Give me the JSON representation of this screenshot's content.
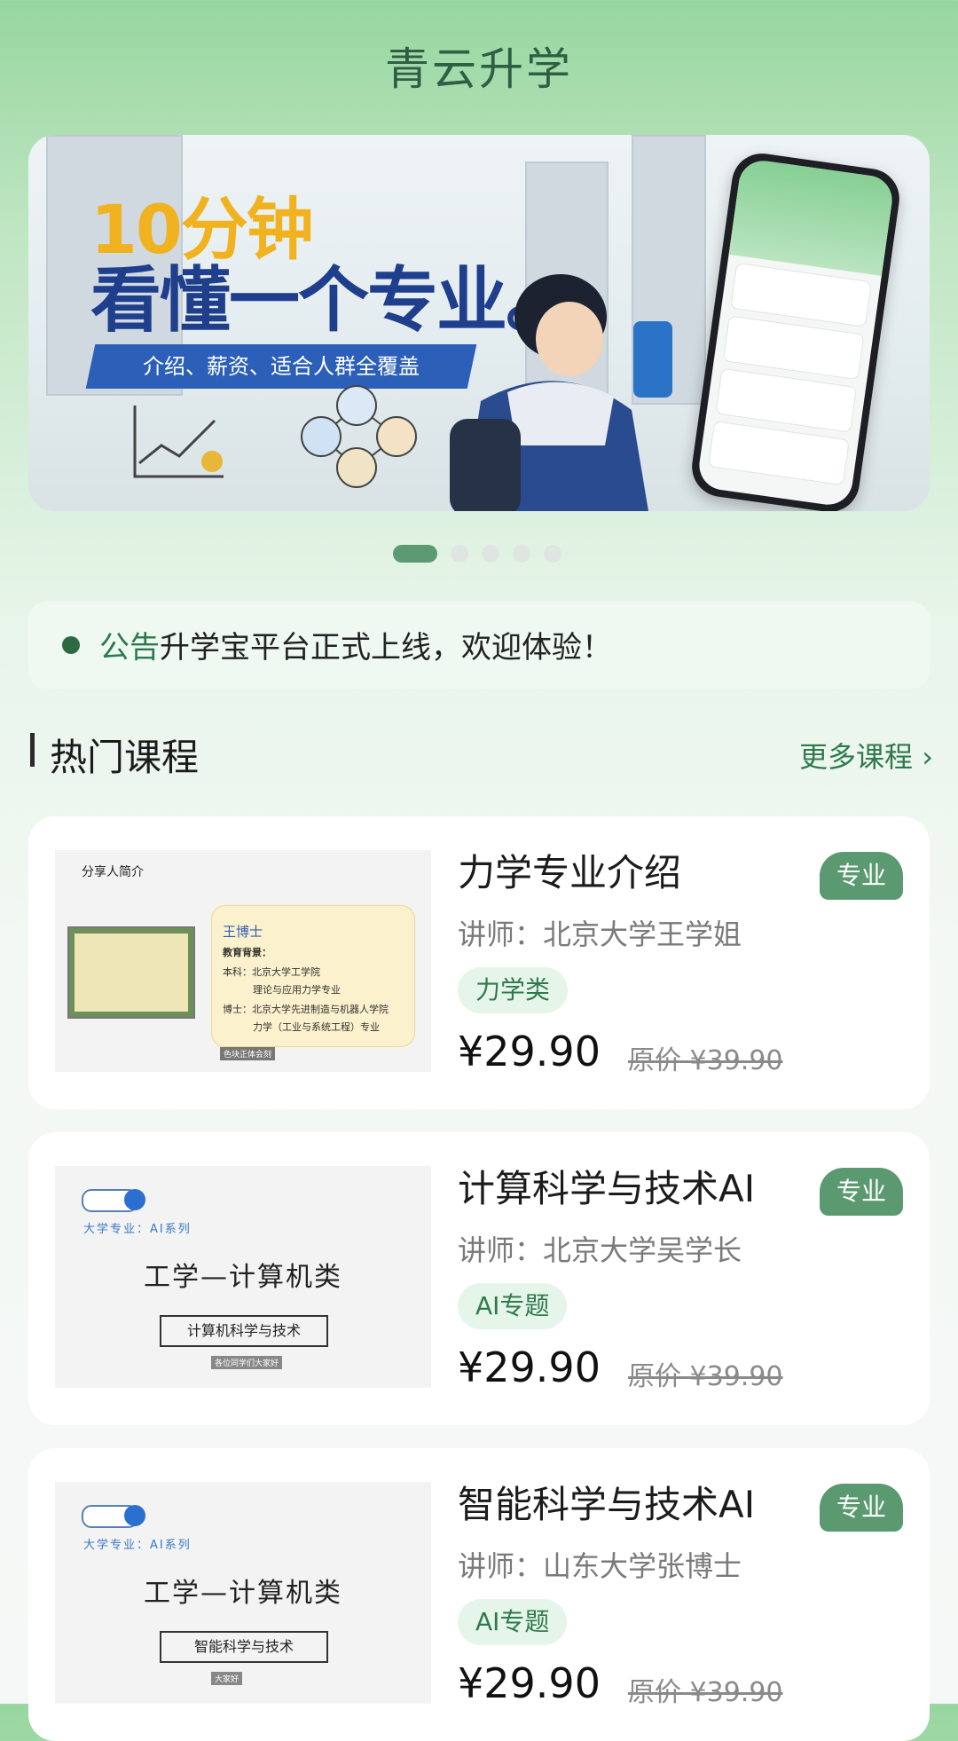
{
  "app": {
    "title": "青云升学"
  },
  "banner": {
    "headline1": "10分钟",
    "headline2": "看懂一个专业。",
    "strip": "介绍、薪资、适合人群全覆盖",
    "slides": 5,
    "active_slide": 1
  },
  "notice": {
    "tag": "公告",
    "text": "升学宝平台正式上线，欢迎体验！"
  },
  "section": {
    "title": "热门课程",
    "more": "更多课程 ›"
  },
  "courses": [
    {
      "title": "力学专业介绍",
      "badge": "专业",
      "teacher": "讲师：北京大学王学姐",
      "tag": "力学类",
      "price": "¥29.90",
      "original": "原价 ¥39.90",
      "thumb": {
        "heading": "分享人简介",
        "name": "王博士",
        "lines": [
          "教育背景：",
          "本科：北京大学工学院",
          "理论与应用力学专业",
          "博士：北京大学先进制造与机器人学院",
          "力学（工业与系统工程）专业"
        ],
        "footer": "色块正体会刻"
      }
    },
    {
      "title": "计算科学与技术AI",
      "badge": "专业",
      "teacher": "讲师：北京大学吴学长",
      "tag": "AI专题",
      "price": "¥29.90",
      "original": "原价 ¥39.90",
      "thumb": {
        "sub": "大学专业：AI系列",
        "big": "工学—计算机类",
        "box": "计算机科学与技术",
        "footer": "各位同学们大家好"
      }
    },
    {
      "title": "智能科学与技术AI",
      "badge": "专业",
      "teacher": "讲师：山东大学张博士",
      "tag": "AI专题",
      "price": "¥29.90",
      "original": "原价 ¥39.90",
      "thumb": {
        "sub": "大学专业：AI系列",
        "big": "工学—计算机类",
        "box": "智能科学与技术",
        "footer": "大家好"
      }
    }
  ],
  "colors": {
    "accent": "#2f7a4c",
    "badge": "#5b9a70",
    "banner_blue": "#1f3f8d",
    "banner_gold": "#f0b21f"
  }
}
